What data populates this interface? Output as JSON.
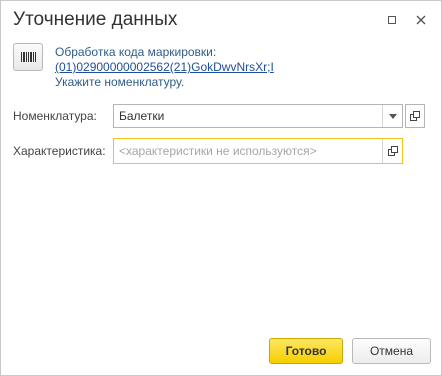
{
  "window": {
    "title": "Уточнение данных"
  },
  "info": {
    "line1": "Обработка кода маркировки:",
    "code_link": "(01)02900000002562(21)GokDwvNrsXr;I",
    "line3": "Укажите номенклатуру."
  },
  "form": {
    "nomenclature_label": "Номенклатура:",
    "nomenclature_value": "Балетки",
    "characteristic_label": "Характеристика:",
    "characteristic_placeholder": "<характеристики не используются>"
  },
  "buttons": {
    "ok": "Готово",
    "cancel": "Отмена"
  },
  "colors": {
    "accent_yellow": "#f5cf00",
    "focus_border": "#f0c419",
    "link": "#1f4f9c"
  }
}
